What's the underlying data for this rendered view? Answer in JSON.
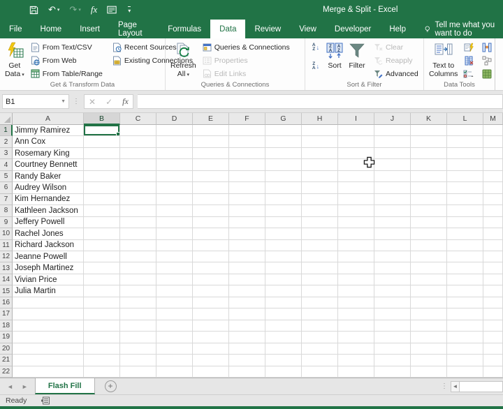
{
  "colors": {
    "accent_green": "#217346",
    "panel_gray": "#e6e6e6",
    "ribbon_bg": "#fdfdfd",
    "grid_line": "#d9d9d9",
    "disabled_text": "#b8b8b8"
  },
  "titlebar": {
    "title": "Merge & Split  -  Excel"
  },
  "tabs": {
    "items": [
      "File",
      "Home",
      "Insert",
      "Page Layout",
      "Formulas",
      "Data",
      "Review",
      "View",
      "Developer",
      "Help"
    ],
    "active": "Data",
    "tell_me": "Tell me what you want to do"
  },
  "ribbon": {
    "get_data": "Get\nData",
    "from_text_csv": "From Text/CSV",
    "from_web": "From Web",
    "from_table_range": "From Table/Range",
    "recent_sources": "Recent Sources",
    "existing_connections": "Existing Connections",
    "group1_label": "Get & Transform Data",
    "refresh_all": "Refresh\nAll",
    "queries_connections": "Queries & Connections",
    "properties": "Properties",
    "edit_links": "Edit Links",
    "group2_label": "Queries & Connections",
    "sort": "Sort",
    "filter": "Filter",
    "clear": "Clear",
    "reapply": "Reapply",
    "advanced": "Advanced",
    "group3_label": "Sort & Filter",
    "text_to_columns": "Text to\nColumns",
    "group4_label": "Data Tools"
  },
  "formula_bar": {
    "name_box": "B1",
    "formula_value": ""
  },
  "sheet": {
    "columns": [
      "A",
      "B",
      "C",
      "D",
      "E",
      "F",
      "G",
      "H",
      "I",
      "J",
      "K",
      "L",
      "M"
    ],
    "row_count": 22,
    "selected_column": "B",
    "selected_row": 1,
    "column_a_values": [
      "Jimmy Ramirez",
      "Ann Cox",
      "Rosemary King",
      "Courtney Bennett",
      "Randy Baker",
      "Audrey Wilson",
      "Kim Hernandez",
      "Kathleen Jackson",
      "Jeffery Powell",
      "Rachel Jones",
      "Richard Jackson",
      "Jeanne Powell",
      "Joseph Martinez",
      "Vivian Price",
      "Julia Martin"
    ]
  },
  "sheet_tabs": {
    "active": "Flash Fill"
  },
  "status_bar": {
    "mode": "Ready"
  }
}
